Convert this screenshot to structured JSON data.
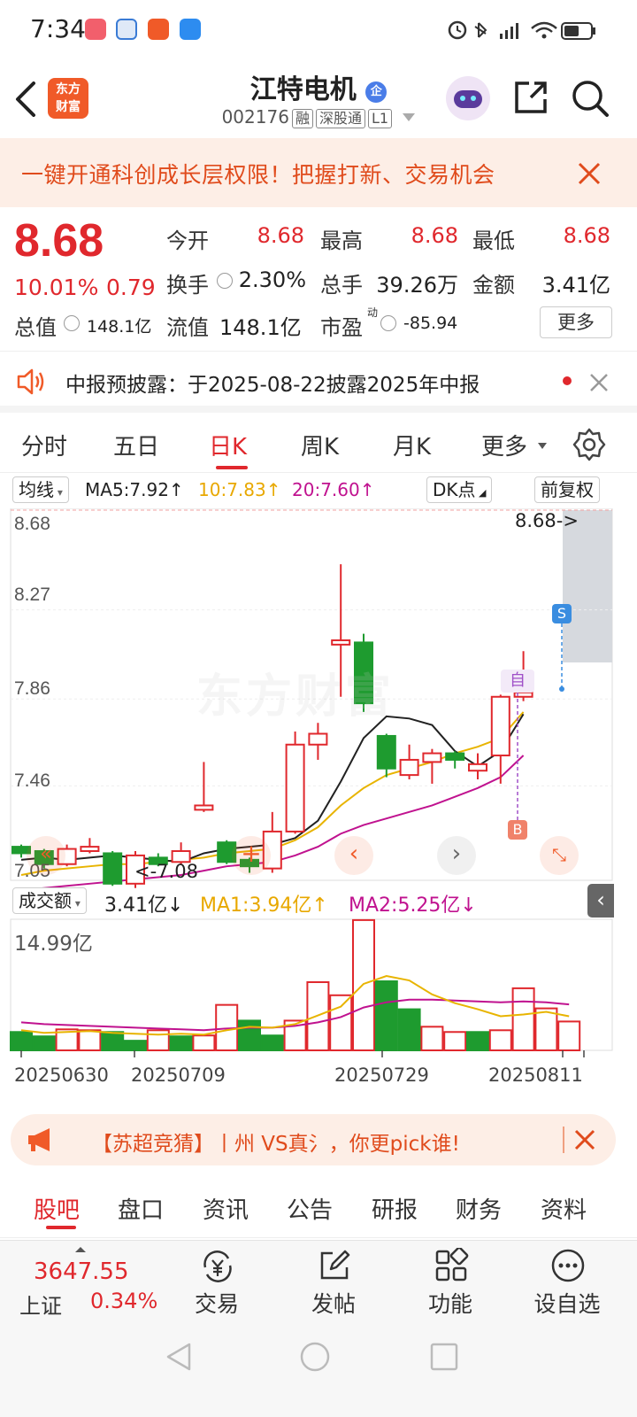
{
  "status_bar": {
    "time": "7:34"
  },
  "header": {
    "back_label": "‹",
    "logo_text_line1": "东方",
    "logo_text_line2": "财富",
    "stock_name": "江特电机",
    "stock_code": "002176",
    "tags": [
      "融",
      "深股通",
      "L1"
    ]
  },
  "banner": {
    "text": "一键开通科创成长层权限！把握打新、交易机会"
  },
  "quote": {
    "price": "8.68",
    "change_pct": "10.01%",
    "change_amt": "0.79",
    "open_label": "今开",
    "open": "8.68",
    "high_label": "最高",
    "high": "8.68",
    "low_label": "最低",
    "low": "8.68",
    "turnover_label": "换手",
    "turnover": "2.30%",
    "volume_label": "总手",
    "volume": "39.26万",
    "amount_label": "金额",
    "amount": "3.41亿",
    "mktcap_label": "总值",
    "mktcap": "148.1亿",
    "float_label": "流值",
    "float_cap": "148.1亿",
    "pe_label": "市盈",
    "pe_sup": "动",
    "pe": "-85.94",
    "more_label": "更多"
  },
  "notice": {
    "text": "中报预披露：于2025-08-22披露2025年中报"
  },
  "k_tabs": [
    "分时",
    "五日",
    "日K",
    "周K",
    "月K",
    "更多"
  ],
  "ma_legend": {
    "selector": "均线",
    "ma5": "MA5:7.92↑",
    "ma10": "10:7.83↑",
    "ma20": "20:7.60↑",
    "dk_label": "DK点",
    "adjust_label": "前复权"
  },
  "chart_data": {
    "type": "candlestick",
    "price_axis": [
      "8.68",
      "8.27",
      "7.86",
      "7.46",
      "7.05"
    ],
    "last_price_label": "8.68->",
    "low_marker_label": "<-7.08",
    "watermark": "东方财富",
    "marker_self": "自",
    "marker_s": "S",
    "marker_b": "B",
    "candles": [
      {
        "o": 7.18,
        "c": 7.15,
        "h": 7.19,
        "l": 7.13
      },
      {
        "o": 7.16,
        "c": 7.1,
        "h": 7.17,
        "l": 7.08
      },
      {
        "o": 7.1,
        "c": 7.17,
        "h": 7.19,
        "l": 7.09
      },
      {
        "o": 7.16,
        "c": 7.18,
        "h": 7.22,
        "l": 7.15
      },
      {
        "o": 7.15,
        "c": 7.01,
        "h": 7.16,
        "l": 7.0
      },
      {
        "o": 7.01,
        "c": 7.14,
        "h": 7.16,
        "l": 6.99
      },
      {
        "o": 7.13,
        "c": 7.1,
        "h": 7.15,
        "l": 7.09
      },
      {
        "o": 7.11,
        "c": 7.16,
        "h": 7.2,
        "l": 7.1
      },
      {
        "o": 7.35,
        "c": 7.37,
        "h": 7.57,
        "l": 7.34
      },
      {
        "o": 7.2,
        "c": 7.11,
        "h": 7.21,
        "l": 7.1
      },
      {
        "o": 7.12,
        "c": 7.09,
        "h": 7.13,
        "l": 7.06
      },
      {
        "o": 7.08,
        "c": 7.25,
        "h": 7.34,
        "l": 7.06
      },
      {
        "o": 7.25,
        "c": 7.65,
        "h": 7.71,
        "l": 7.24
      },
      {
        "o": 7.65,
        "c": 7.7,
        "h": 7.75,
        "l": 7.58
      },
      {
        "o": 8.11,
        "c": 8.13,
        "h": 8.48,
        "l": 7.87
      },
      {
        "o": 8.12,
        "c": 7.84,
        "h": 8.16,
        "l": 7.8
      },
      {
        "o": 7.69,
        "c": 7.54,
        "h": 7.7,
        "l": 7.5
      },
      {
        "o": 7.51,
        "c": 7.58,
        "h": 7.65,
        "l": 7.49
      },
      {
        "o": 7.57,
        "c": 7.61,
        "h": 7.63,
        "l": 7.47
      },
      {
        "o": 7.61,
        "c": 7.58,
        "h": 7.62,
        "l": 7.54
      },
      {
        "o": 7.53,
        "c": 7.56,
        "h": 7.61,
        "l": 7.49
      },
      {
        "o": 7.6,
        "c": 7.87,
        "h": 7.88,
        "l": 7.47
      },
      {
        "o": 7.87,
        "c": 7.89,
        "h": 8.08,
        "l": 7.85
      }
    ],
    "ma5": [
      7.12,
      7.13,
      7.12,
      7.13,
      7.14,
      7.13,
      7.12,
      7.11,
      7.15,
      7.17,
      7.18,
      7.19,
      7.22,
      7.3,
      7.48,
      7.68,
      7.78,
      7.77,
      7.74,
      7.62,
      7.55,
      7.62,
      7.79
    ],
    "ma10": [
      7.05,
      7.07,
      7.08,
      7.09,
      7.1,
      7.1,
      7.11,
      7.12,
      7.13,
      7.15,
      7.16,
      7.17,
      7.21,
      7.27,
      7.37,
      7.45,
      7.51,
      7.54,
      7.57,
      7.61,
      7.64,
      7.68,
      7.8
    ],
    "ma20": [
      6.98,
      6.99,
      7.0,
      7.01,
      7.02,
      7.03,
      7.04,
      7.05,
      7.07,
      7.09,
      7.1,
      7.11,
      7.14,
      7.18,
      7.24,
      7.28,
      7.31,
      7.34,
      7.37,
      7.41,
      7.45,
      7.5,
      7.6
    ],
    "volume": {
      "selector": "成交额",
      "current": "3.41亿↓",
      "ma1": "MA1:3.94亿↑",
      "ma2": "MA2:5.25亿↓",
      "max_label": "14.99亿",
      "bars": [
        2.1,
        1.6,
        2.4,
        2.3,
        2.1,
        1.1,
        2.3,
        1.6,
        1.7,
        5.2,
        3.4,
        1.7,
        3.4,
        7.8,
        6.3,
        14.9,
        7.9,
        4.7,
        2.7,
        2.1,
        2.1,
        2.3,
        7.1,
        4.8,
        3.3
      ],
      "up": [
        false,
        false,
        true,
        true,
        false,
        false,
        true,
        false,
        true,
        true,
        false,
        false,
        true,
        true,
        true,
        true,
        false,
        false,
        true,
        true,
        false,
        true,
        true,
        true,
        true
      ]
    },
    "dates": [
      "20250630",
      "20250709",
      "20250729",
      "20250811"
    ]
  },
  "ad": {
    "text": "【苏超竞猜】丨州 VS真氵，你更pick谁!"
  },
  "f_tabs": [
    "股吧",
    "盘口",
    "资讯",
    "公告",
    "研报",
    "财务",
    "资料"
  ],
  "toolbar": {
    "index_value": "3647.55",
    "index_name": "上证",
    "index_change": "0.34%",
    "items": [
      "交易",
      "发帖",
      "功能",
      "设自选"
    ]
  }
}
